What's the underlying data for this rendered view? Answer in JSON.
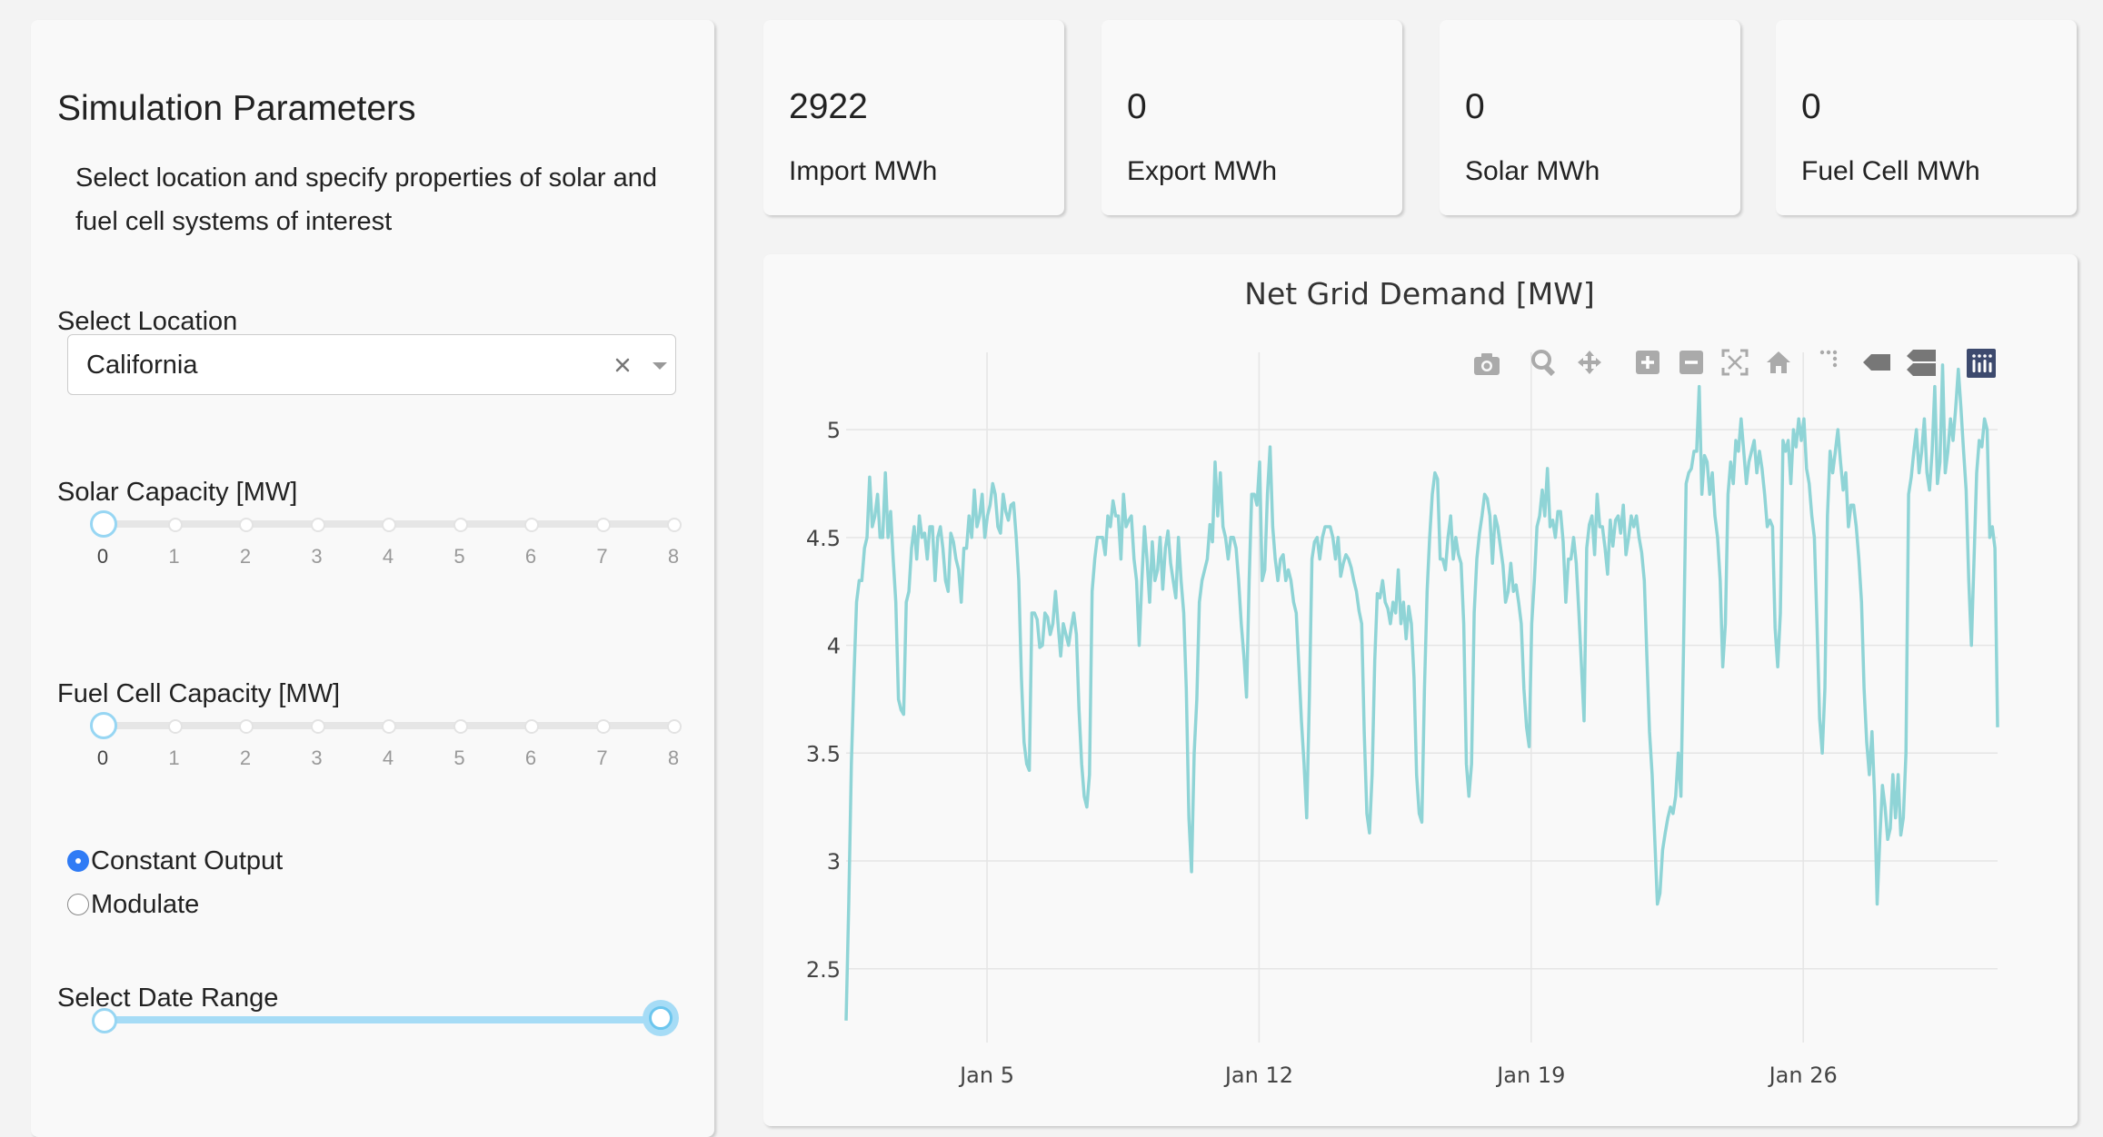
{
  "sidebar": {
    "title": "Simulation Parameters",
    "description": "Select location and specify properties of solar and fuel cell systems of interest",
    "location_label": "Select Location",
    "location_value": "California",
    "solar_label": "Solar Capacity [MW]",
    "solar_value": 0,
    "fuel_label": "Fuel Cell Capacity [MW]",
    "fuel_value": 0,
    "ticks": [
      "0",
      "1",
      "2",
      "3",
      "4",
      "5",
      "6",
      "7",
      "8"
    ],
    "mode_options": [
      "Constant Output",
      "Modulate"
    ],
    "mode_selected": "Constant Output",
    "date_label": "Select Date Range"
  },
  "metrics": [
    {
      "value": "2922",
      "label": "Import MWh"
    },
    {
      "value": "0",
      "label": "Export MWh"
    },
    {
      "value": "0",
      "label": "Solar MWh"
    },
    {
      "value": "0",
      "label": "Fuel Cell MWh"
    }
  ],
  "modebar": [
    "camera-icon",
    "zoom-icon",
    "pan-icon",
    "zoom-in-icon",
    "zoom-out-icon",
    "autoscale-icon",
    "reset-axes-icon",
    "spike-lines-icon",
    "hover-closest-icon",
    "hover-compare-icon",
    "plotly-logo-icon"
  ],
  "chart_data": {
    "type": "line",
    "title": "Net Grid Demand [MW]",
    "xlabel": "",
    "ylabel": "",
    "x_start": "2020-01-01T00:00",
    "x_step_hours": 1,
    "xlim": [
      "2020-01-01T09:00",
      "2020-01-31T00:00"
    ],
    "ylim": [
      2.2,
      5.35
    ],
    "xticks": [
      "2020-01-05",
      "2020-01-12",
      "2020-01-19",
      "2020-01-26"
    ],
    "xtick_labels": [
      "Jan 5",
      "Jan 12",
      "Jan 19",
      "Jan 26"
    ],
    "yticks": [
      2.5,
      3,
      3.5,
      4,
      4.5,
      5
    ],
    "ytick_labels": [
      "2.5",
      "3",
      "3.5",
      "4",
      "4.5",
      "5"
    ],
    "grid": true,
    "color": "#8fd4d6",
    "series": [
      {
        "values": [
          2.26,
          2.8,
          3.45,
          3.85,
          4.2,
          4.3,
          4.3,
          4.45,
          4.5,
          4.78,
          4.55,
          4.6,
          4.7,
          4.5,
          4.5,
          4.8,
          4.5,
          4.62,
          4.4,
          4.2,
          3.75,
          3.7,
          3.68,
          4.2,
          4.25,
          4.45,
          4.55,
          4.4,
          4.6,
          4.5,
          4.52,
          4.4,
          4.55,
          4.55,
          4.3,
          4.5,
          4.55,
          4.45,
          4.3,
          4.25,
          4.52,
          4.48,
          4.4,
          4.35,
          4.2,
          4.45,
          4.45,
          4.6,
          4.5,
          4.72,
          4.55,
          4.6,
          4.7,
          4.5,
          4.6,
          4.65,
          4.75,
          4.7,
          4.55,
          4.52,
          4.7,
          4.62,
          4.58,
          4.65,
          4.66,
          4.5,
          4.3,
          3.85,
          3.55,
          3.45,
          3.42,
          4.15,
          4.15,
          4.12,
          3.99,
          4.0,
          4.15,
          4.13,
          4.05,
          4.1,
          4.25,
          4.1,
          3.95,
          4.1,
          4.05,
          4.0,
          4.08,
          4.15,
          4.05,
          3.7,
          3.45,
          3.3,
          3.25,
          3.4,
          4.25,
          4.4,
          4.5,
          4.5,
          4.5,
          4.42,
          4.6,
          4.55,
          4.67,
          4.6,
          4.6,
          4.4,
          4.7,
          4.55,
          4.58,
          4.6,
          4.4,
          4.3,
          4.0,
          4.3,
          4.55,
          4.4,
          4.2,
          4.48,
          4.3,
          4.35,
          4.5,
          4.26,
          4.45,
          4.53,
          4.38,
          4.3,
          4.22,
          4.5,
          4.3,
          4.15,
          3.8,
          3.2,
          2.95,
          3.5,
          3.75,
          4.2,
          4.3,
          4.35,
          4.4,
          4.56,
          4.48,
          4.85,
          4.6,
          4.8,
          4.55,
          4.5,
          4.4,
          4.5,
          4.5,
          4.45,
          4.3,
          4.1,
          3.95,
          3.76,
          4.3,
          4.7,
          4.7,
          4.65,
          4.85,
          4.3,
          4.35,
          4.7,
          4.92,
          4.55,
          4.4,
          4.3,
          4.4,
          4.42,
          4.3,
          4.35,
          4.3,
          4.2,
          4.15,
          3.9,
          3.65,
          3.45,
          3.2,
          3.75,
          4.4,
          4.48,
          4.5,
          4.4,
          4.5,
          4.55,
          4.55,
          4.55,
          4.5,
          4.4,
          4.5,
          4.32,
          4.38,
          4.42,
          4.4,
          4.36,
          4.3,
          4.25,
          4.16,
          4.1,
          3.6,
          3.22,
          3.13,
          3.4,
          3.93,
          4.24,
          4.22,
          4.3,
          4.2,
          4.17,
          4.1,
          4.2,
          4.15,
          4.35,
          4.1,
          4.2,
          4.03,
          4.18,
          4.1,
          3.85,
          3.4,
          3.22,
          3.18,
          3.8,
          4.25,
          4.5,
          4.7,
          4.8,
          4.77,
          4.4,
          4.4,
          4.35,
          4.5,
          4.6,
          4.4,
          4.5,
          4.42,
          4.38,
          4.1,
          3.45,
          3.3,
          3.45,
          4.15,
          4.4,
          4.52,
          4.6,
          4.7,
          4.68,
          4.6,
          4.38,
          4.6,
          4.55,
          4.46,
          4.37,
          4.2,
          4.25,
          4.38,
          4.25,
          4.28,
          4.2,
          4.1,
          3.8,
          3.62,
          3.53,
          4.1,
          4.3,
          4.55,
          4.6,
          4.72,
          4.6,
          4.82,
          4.55,
          4.58,
          4.5,
          4.62,
          4.62,
          4.48,
          4.2,
          4.4,
          4.4,
          4.5,
          4.38,
          4.15,
          3.9,
          3.65,
          4.45,
          4.56,
          4.6,
          4.42,
          4.7,
          4.55,
          4.55,
          4.45,
          4.33,
          4.58,
          4.46,
          4.58,
          4.6,
          4.52,
          4.65,
          4.42,
          4.5,
          4.6,
          4.55,
          4.6,
          4.5,
          4.43,
          4.3,
          3.95,
          3.6,
          3.4,
          3.1,
          2.8,
          2.85,
          3.05,
          3.13,
          3.2,
          3.25,
          3.22,
          3.3,
          3.5,
          3.3,
          4.0,
          4.75,
          4.8,
          4.82,
          4.9,
          4.9,
          5.2,
          4.7,
          4.88,
          4.85,
          4.7,
          4.8,
          4.6,
          4.5,
          4.3,
          3.9,
          4.1,
          4.7,
          4.85,
          4.75,
          4.95,
          4.9,
          5.05,
          4.9,
          4.75,
          4.85,
          4.9,
          4.95,
          4.8,
          4.9,
          4.82,
          4.7,
          4.55,
          4.58,
          4.55,
          4.08,
          3.9,
          4.15,
          4.95,
          4.9,
          4.95,
          4.75,
          5.0,
          4.92,
          5.05,
          4.95,
          5.05,
          4.82,
          4.75,
          4.6,
          4.5,
          4.1,
          3.66,
          3.5,
          3.8,
          4.6,
          4.9,
          4.8,
          4.9,
          5.0,
          4.85,
          4.72,
          4.8,
          4.55,
          4.65,
          4.65,
          4.55,
          4.4,
          4.2,
          3.8,
          3.55,
          3.4,
          3.6,
          3.3,
          2.8,
          3.1,
          3.35,
          3.25,
          3.1,
          3.15,
          3.4,
          3.2,
          3.4,
          3.12,
          3.2,
          3.5,
          4.7,
          4.78,
          4.9,
          5.0,
          4.8,
          4.9,
          5.05,
          4.8,
          4.72,
          4.9,
          5.2,
          4.75,
          4.85,
          5.3,
          4.8,
          4.9,
          5.05,
          4.95,
          5.1,
          5.28,
          5.1,
          4.9,
          4.72,
          4.3,
          4.0,
          4.4,
          4.8,
          4.95,
          4.92,
          5.05,
          5.0,
          4.5,
          4.55,
          4.45,
          3.62
        ]
      }
    ]
  }
}
